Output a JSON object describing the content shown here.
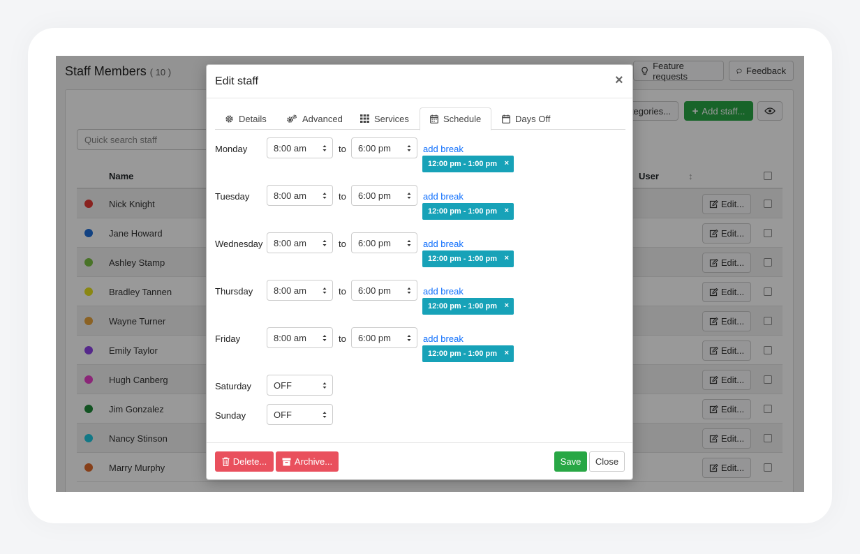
{
  "page": {
    "title": "Staff Members",
    "count": "( 10 )",
    "header_buttons": {
      "feature_requests": "Feature requests",
      "feedback": "Feedback"
    },
    "categories_label": "tegories...",
    "add_staff_label": "Add staff...",
    "search_placeholder": "Quick search staff",
    "columns": {
      "name": "Name",
      "user": "User",
      "sort": "↕"
    },
    "edit_label": "Edit...",
    "staff": [
      {
        "name": "Nick Knight",
        "color": "#e53935"
      },
      {
        "name": "Jane Howard",
        "color": "#1e6fd9"
      },
      {
        "name": "Ashley Stamp",
        "color": "#7bc043"
      },
      {
        "name": "Bradley Tannen",
        "color": "#e6e21e"
      },
      {
        "name": "Wayne Turner",
        "color": "#e8a33d"
      },
      {
        "name": "Emily Taylor",
        "color": "#8e44e8"
      },
      {
        "name": "Hugh Canberg",
        "color": "#e840c8"
      },
      {
        "name": "Jim Gonzalez",
        "color": "#1e8a3a"
      },
      {
        "name": "Nancy Stinson",
        "color": "#1ec8e0"
      },
      {
        "name": "Marry Murphy",
        "color": "#e06a2a"
      }
    ]
  },
  "modal": {
    "title": "Edit staff",
    "close_symbol": "×",
    "tabs": [
      {
        "label": "Details",
        "icon": "gear-icon"
      },
      {
        "label": "Advanced",
        "icon": "gears-icon"
      },
      {
        "label": "Services",
        "icon": "grid-icon"
      },
      {
        "label": "Schedule",
        "icon": "calendar-icon",
        "active": true
      },
      {
        "label": "Days Off",
        "icon": "calendar-blank-icon"
      }
    ],
    "to_label": "to",
    "add_break_label": "add break",
    "schedule": [
      {
        "day": "Monday",
        "start": "8:00 am",
        "end": "6:00 pm",
        "break": "12:00 pm - 1:00 pm"
      },
      {
        "day": "Tuesday",
        "start": "8:00 am",
        "end": "6:00 pm",
        "break": "12:00 pm - 1:00 pm"
      },
      {
        "day": "Wednesday",
        "start": "8:00 am",
        "end": "6:00 pm",
        "break": "12:00 pm - 1:00 pm"
      },
      {
        "day": "Thursday",
        "start": "8:00 am",
        "end": "6:00 pm",
        "break": "12:00 pm - 1:00 pm"
      },
      {
        "day": "Friday",
        "start": "8:00 am",
        "end": "6:00 pm",
        "break": "12:00 pm - 1:00 pm"
      },
      {
        "day": "Saturday",
        "start": "OFF"
      },
      {
        "day": "Sunday",
        "start": "OFF"
      }
    ],
    "break_remove_symbol": "×",
    "footer": {
      "delete": "Delete...",
      "archive": "Archive...",
      "save": "Save",
      "close": "Close"
    }
  }
}
